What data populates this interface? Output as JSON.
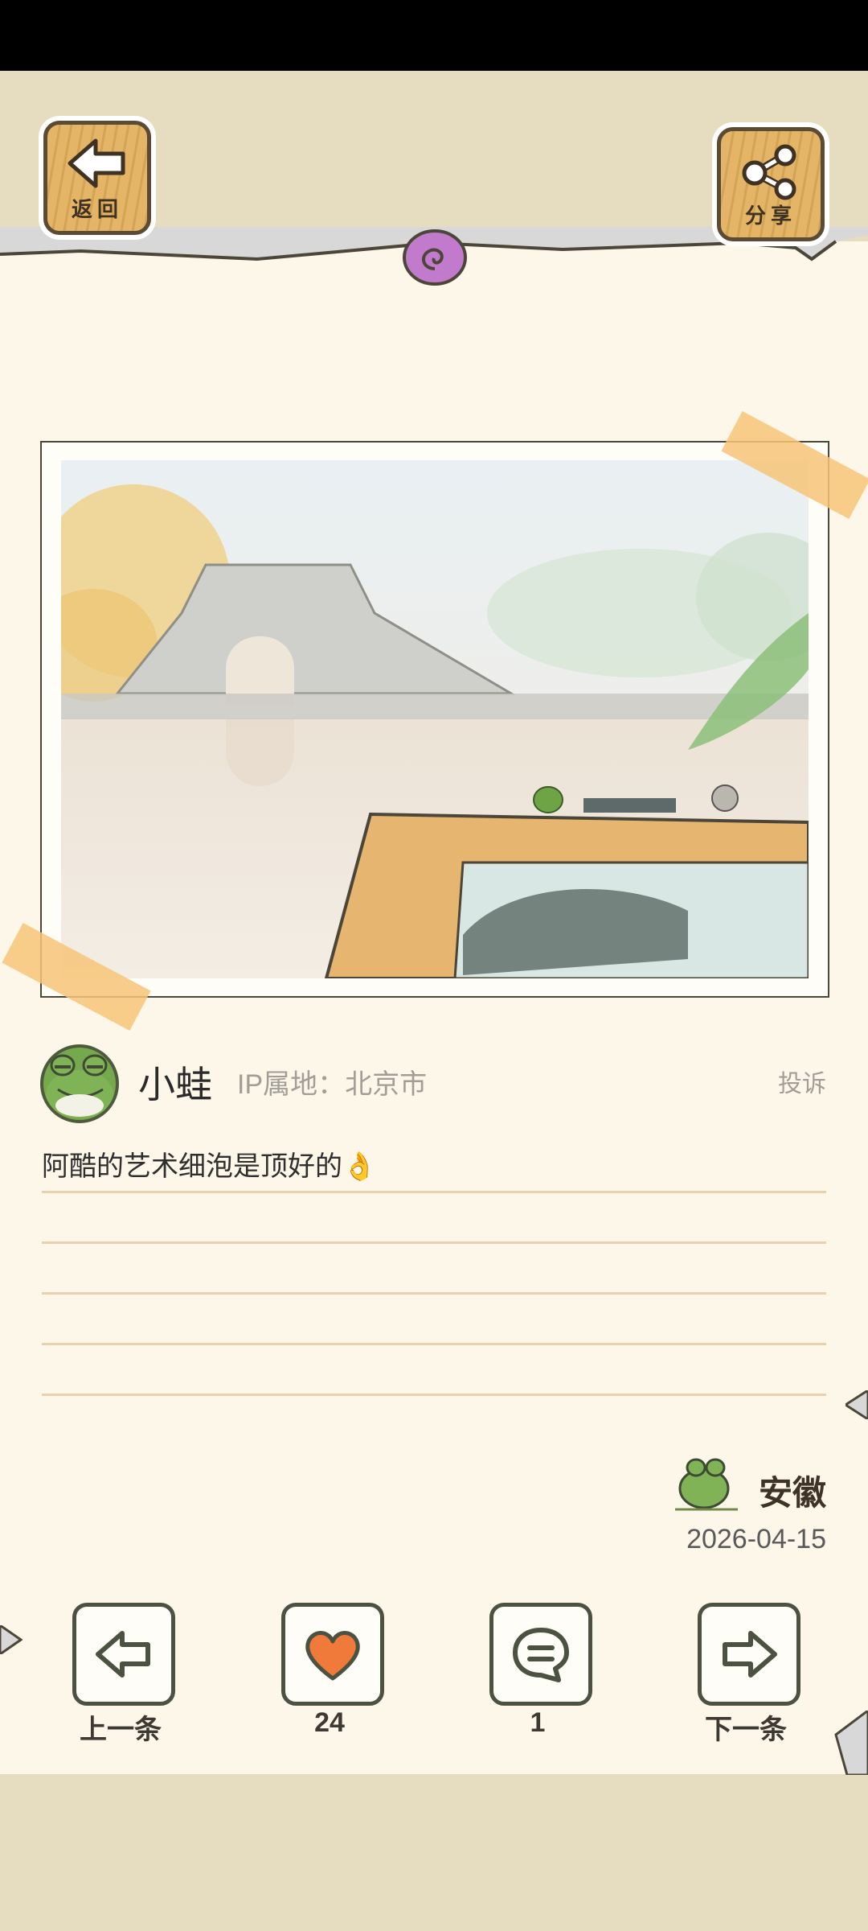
{
  "header": {
    "back_label": "返回",
    "share_label": "分享"
  },
  "post": {
    "username": "小蛙",
    "ip_location": "IP属地：北京市",
    "complain_label": "投诉",
    "text": "阿酷的艺术细泡是顶好的👌",
    "signature_place": "安徽",
    "date": "2026-04-15"
  },
  "bottom_nav": {
    "prev_label": "上一条",
    "likes_count": "24",
    "comments_count": "1",
    "next_label": "下一条"
  },
  "colors": {
    "paper": "#fdf7e9",
    "background": "#e6dcbf",
    "wood": "#e4b566",
    "heart": "#f07a3a",
    "frog_green": "#76a84d"
  },
  "icons": {
    "back": "left-arrow-icon",
    "share": "share-icon",
    "prev": "left-arrow-outline-icon",
    "like": "heart-icon",
    "comment": "speech-bubble-icon",
    "next": "right-arrow-outline-icon"
  }
}
